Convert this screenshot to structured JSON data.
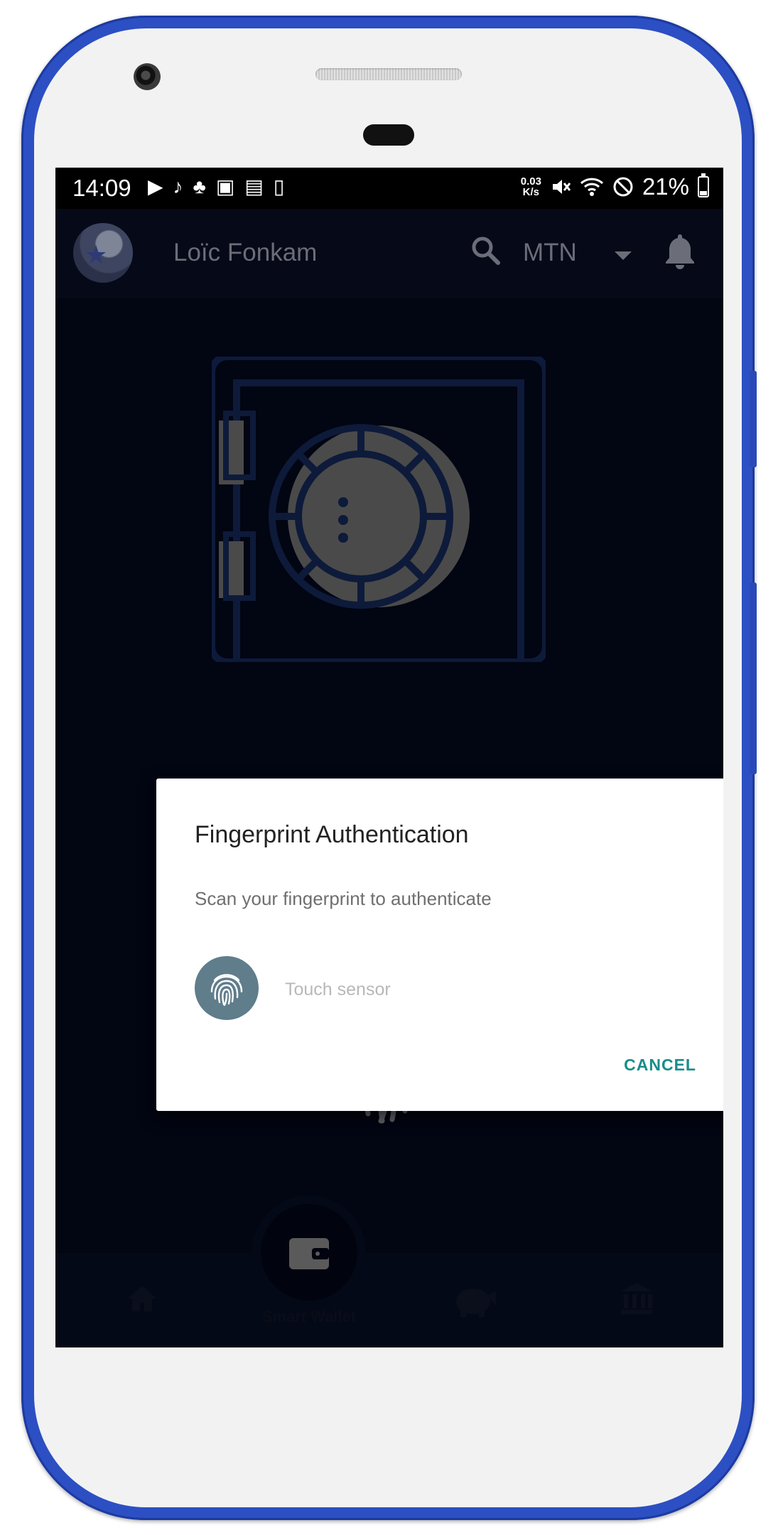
{
  "status_bar": {
    "time": "14:09",
    "net_speed_top": "0.03",
    "net_speed_bottom": "K/s",
    "battery_percent": "21%",
    "left_icons": [
      "play-icon",
      "music-note-icon",
      "cat-icon",
      "image-icon",
      "calendar-icon",
      "sim-icon"
    ],
    "right_icons": [
      "mute-icon",
      "wifi-icon",
      "block-icon",
      "battery-icon"
    ]
  },
  "app_bar": {
    "user_name": "Loïc Fonkam",
    "network": "MTN"
  },
  "dialog": {
    "title": "Fingerprint Authentication",
    "description": "Scan your fingerprint to authenticate",
    "sensor_label": "Touch sensor",
    "cancel_label": "CANCEL"
  },
  "bottom_nav": {
    "center_label": "Smart Wallet",
    "items": [
      "home-icon",
      "wallet-icon",
      "piggy-bank-icon",
      "bank-icon"
    ]
  },
  "colors": {
    "frame": "#2c4fc3",
    "screen_background": "#020512",
    "dialog_accent": "#1a8c8a",
    "fingerprint_circle": "#607d8b"
  }
}
